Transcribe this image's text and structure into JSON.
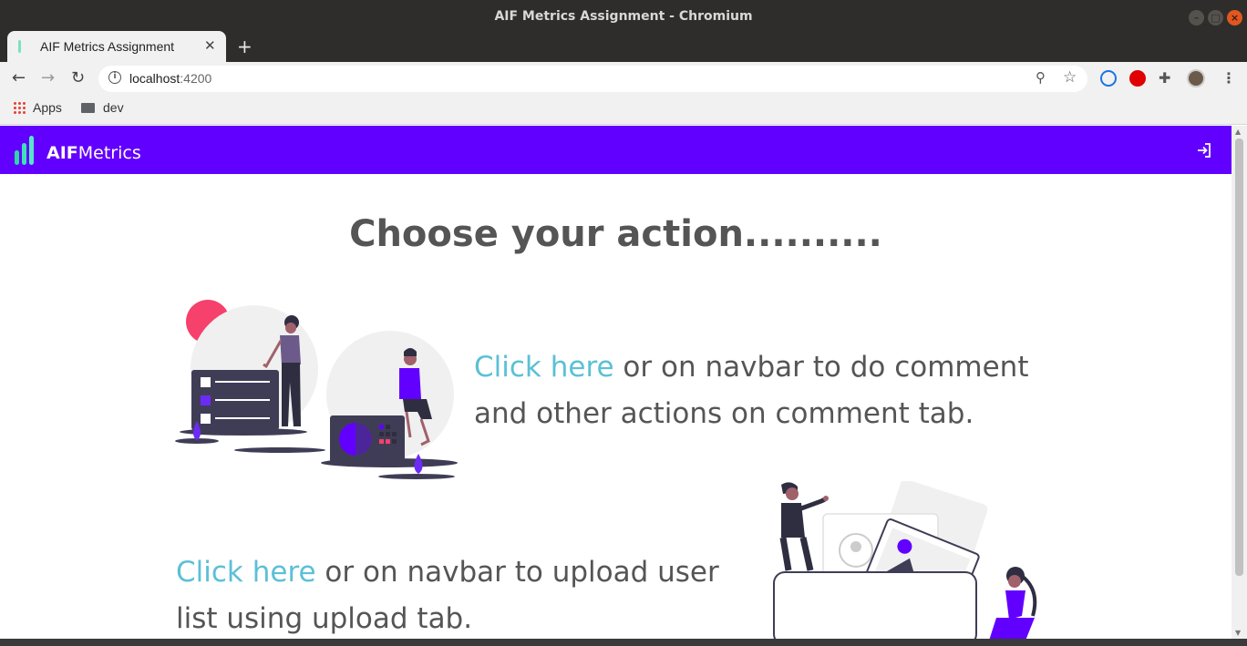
{
  "window": {
    "title": "AIF Metrics Assignment - Chromium"
  },
  "browser": {
    "tab_title": "AIF Metrics Assignment",
    "tab_close": "✕",
    "new_tab": "+",
    "url_host": "localhost",
    "url_port": ":4200",
    "bookmarks": {
      "apps_label": "Apps",
      "dev_label": "dev"
    }
  },
  "app": {
    "brand_bold": "AIF",
    "brand_regular": "Metrics",
    "heading": "Choose your action..........",
    "sections": [
      {
        "link_text": "Click here",
        "text": " or on navbar to do comment and other actions on comment tab."
      },
      {
        "link_text": "Click here",
        "text": " or on navbar to upload user list using upload tab."
      }
    ]
  },
  "colors": {
    "navbar": "#6200ff",
    "link": "#5bc0d6",
    "text": "#555555",
    "logo": "#3fe0b8"
  },
  "icons": {
    "navbar_right": "sign-in-icon"
  }
}
